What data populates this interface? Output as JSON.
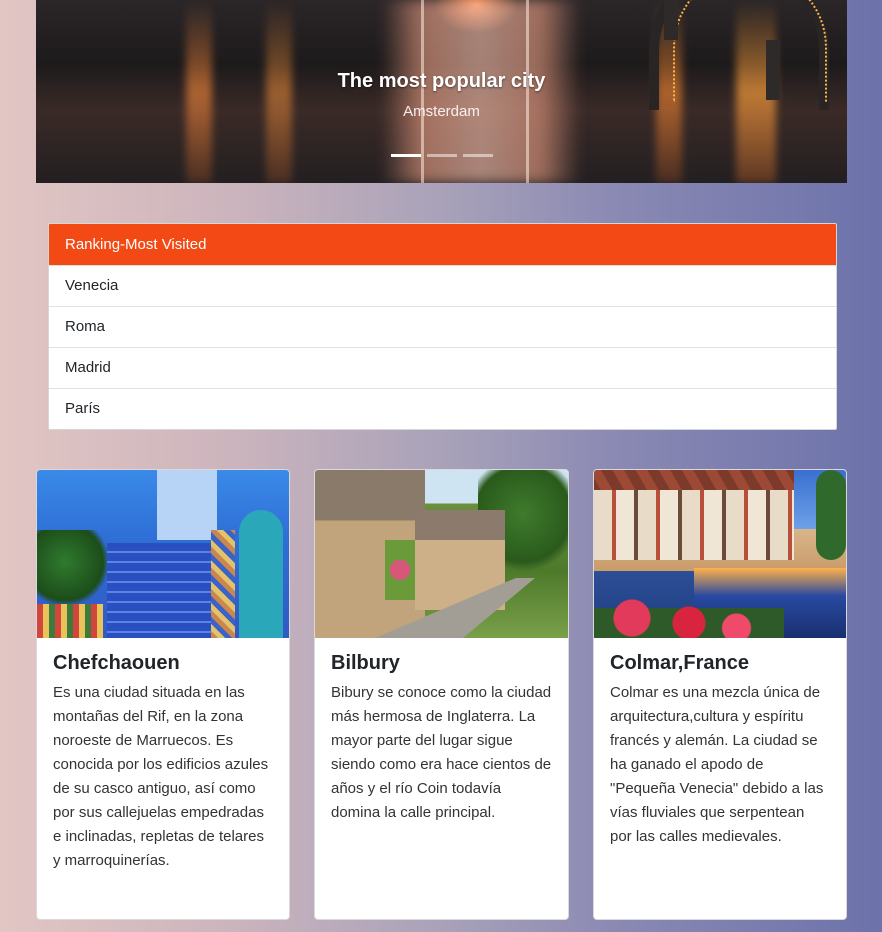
{
  "carousel": {
    "title": "The most popular city",
    "subtitle": "Amsterdam",
    "slides_count": 3,
    "active_slide": 1
  },
  "ranking": {
    "header": "Ranking-Most Visited",
    "items": [
      "Venecia",
      "Roma",
      "Madrid",
      "París"
    ],
    "header_color": "#f24915"
  },
  "cards": [
    {
      "title": "Chefchaouen",
      "text": "Es una ciudad situada en las montañas del Rif, en la zona noroeste de Marruecos. Es conocida por los edificios azules de su casco antiguo, así como por sus callejuelas empedradas e inclinadas, repletas de telares y marroquinerías."
    },
    {
      "title": "Bilbury",
      "text": "Bibury se conoce como la ciudad más hermosa de Inglaterra. La mayor parte del lugar sigue siendo como era hace cientos de años y el río Coin todavía domina la calle principal."
    },
    {
      "title": "Colmar,France",
      "text": "Colmar es una mezcla única de arquitectura,cultura y espíritu francés y alemán. La ciudad se ha ganado el apodo de \"Pequeña Venecia\" debido a las vías fluviales que serpentean por las calles medievales."
    }
  ]
}
